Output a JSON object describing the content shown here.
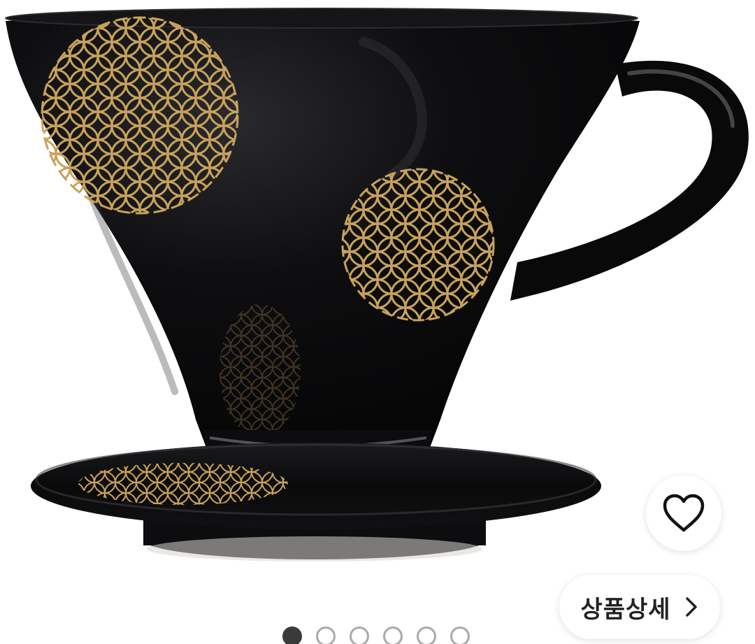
{
  "product": {
    "image_alt": "",
    "colors": {
      "glaze": "#0b0b0d",
      "gold": "#c9a25a",
      "highlight": "#6a6a70"
    }
  },
  "wishlist": {
    "icon": "heart-outline-icon"
  },
  "detail_button": {
    "label": "상품상세",
    "icon": "chevron-right-icon"
  },
  "pager": {
    "total": 6,
    "active_index": 0
  }
}
